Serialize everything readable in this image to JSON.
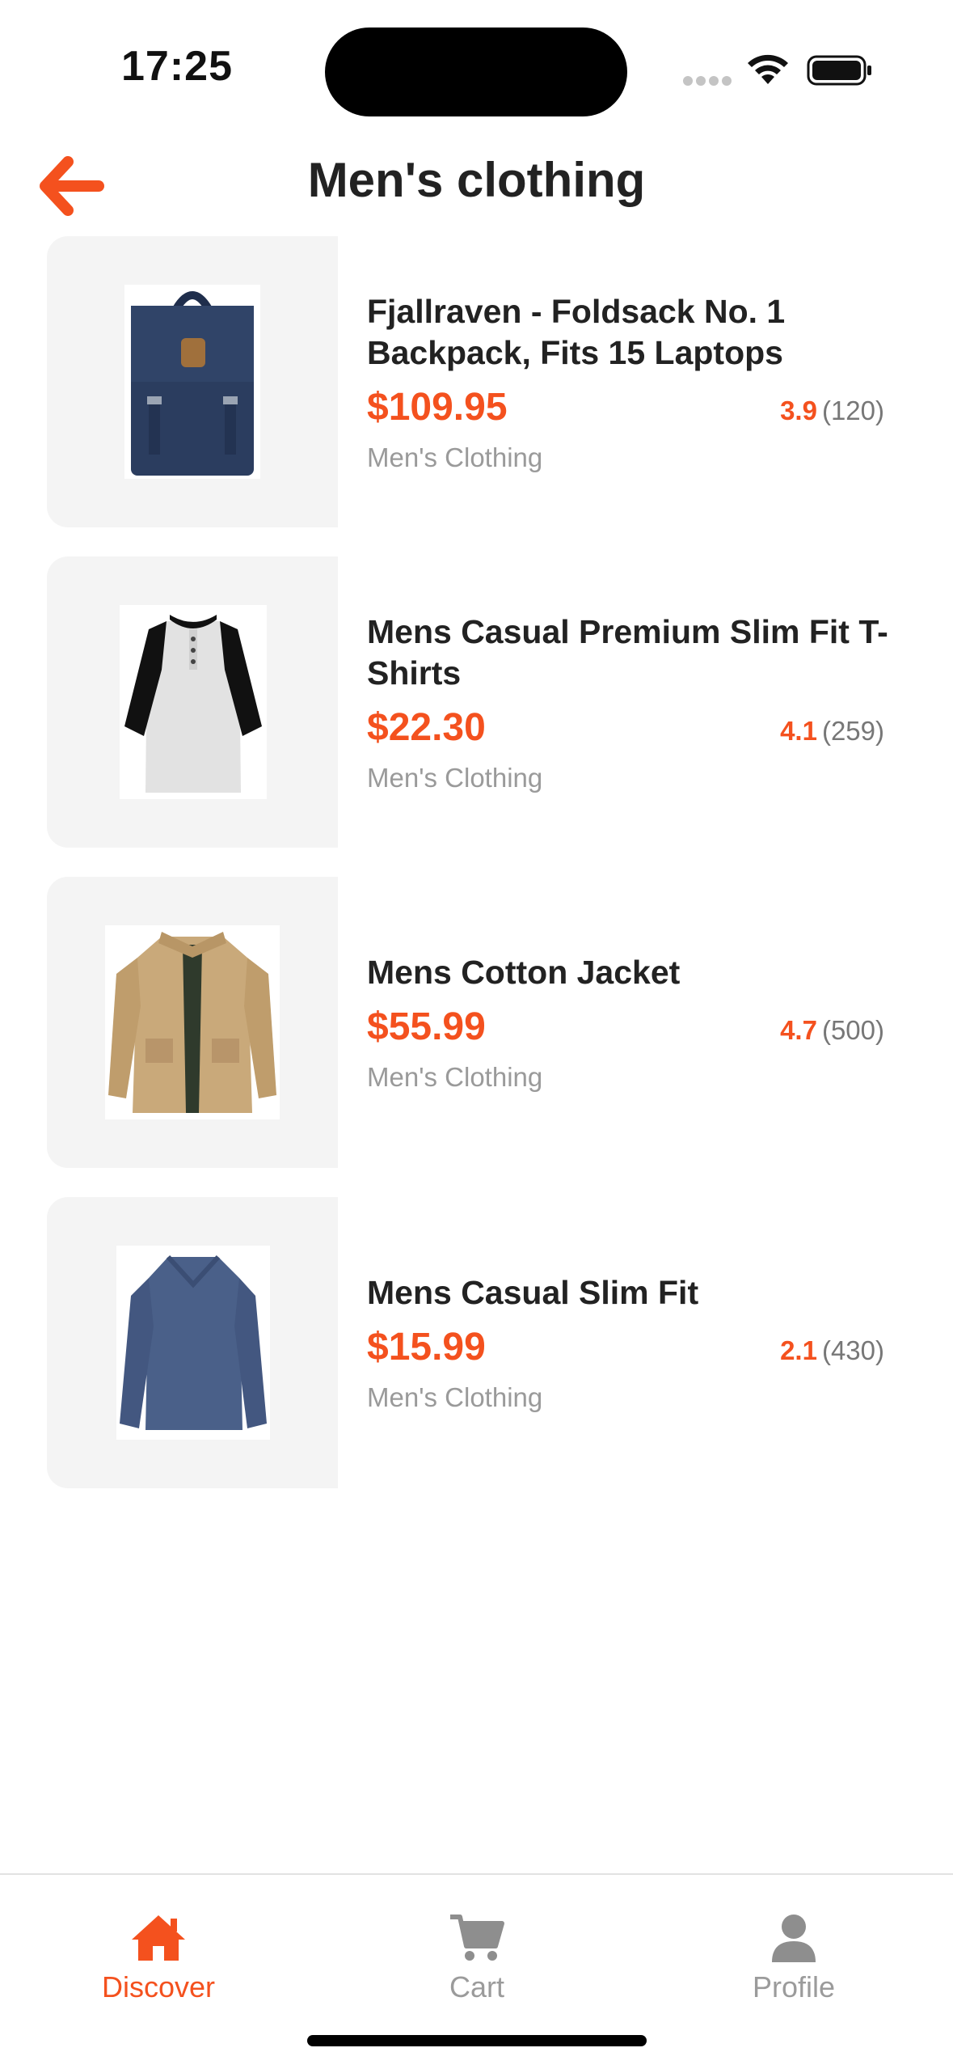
{
  "status_bar": {
    "time": "17:25",
    "icons": [
      "signal-dots-icon",
      "wifi-icon",
      "battery-icon"
    ]
  },
  "header": {
    "title": "Men's clothing",
    "back_icon": "arrow-left-icon"
  },
  "colors": {
    "accent": "#f4511e",
    "text": "#222222",
    "muted": "#9a9a9a",
    "thumb_bg": "#f4f4f4"
  },
  "products": [
    {
      "name": "Fjallraven - Foldsack No. 1 Backpack, Fits 15 Laptops",
      "price": "$109.95",
      "rating": "3.9",
      "rating_count": "(120)",
      "category": "Men's Clothing",
      "image_icon": "backpack-image"
    },
    {
      "name": "Mens Casual Premium Slim Fit T-Shirts",
      "price": "$22.30",
      "rating": "4.1",
      "rating_count": "(259)",
      "category": "Men's Clothing",
      "image_icon": "raglan-tshirt-image"
    },
    {
      "name": "Mens Cotton Jacket",
      "price": "$55.99",
      "rating": "4.7",
      "rating_count": "(500)",
      "category": "Men's Clothing",
      "image_icon": "jacket-image"
    },
    {
      "name": "Mens Casual Slim Fit",
      "price": "$15.99",
      "rating": "2.1",
      "rating_count": "(430)",
      "category": "Men's Clothing",
      "image_icon": "longsleeve-tshirt-image"
    }
  ],
  "tab_bar": {
    "tabs": [
      {
        "label": "Discover",
        "icon": "home-icon",
        "active": true
      },
      {
        "label": "Cart",
        "icon": "cart-icon",
        "active": false
      },
      {
        "label": "Profile",
        "icon": "person-icon",
        "active": false
      }
    ]
  }
}
